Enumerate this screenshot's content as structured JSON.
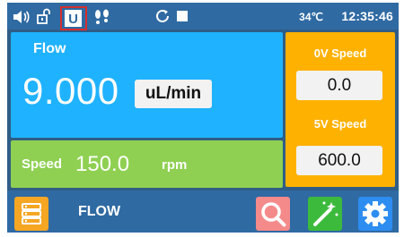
{
  "status_bar": {
    "temperature": "34℃",
    "time": "12:35:46",
    "icons": [
      "speaker-icon",
      "unlock-icon",
      "u-mode-icon",
      "footprint-icon",
      "refresh-icon",
      "stop-icon"
    ]
  },
  "flow_panel": {
    "title": "Flow",
    "value": "9.000",
    "unit": "uL/min"
  },
  "speed_panel": {
    "label": "Speed",
    "value": "150.0",
    "unit": "rpm"
  },
  "right_panel": {
    "zero_v_label": "0V Speed",
    "zero_v_value": "0.0",
    "five_v_label": "5V Speed",
    "five_v_value": "600.0"
  },
  "bottom_bar": {
    "mode_label": "FLOW",
    "icons": [
      "menu-list-icon",
      "search-icon",
      "magic-wand-icon",
      "settings-gear-icon"
    ]
  },
  "colors": {
    "status_bar": "#2f6aa2",
    "flow_panel": "#1fb2ff",
    "speed_panel": "#8fd052",
    "right_panel": "#ffb100",
    "menu_button": "#f5a623",
    "search_button": "#f58a8a",
    "wand_button": "#3cba3c",
    "settings_button": "#2d8df0",
    "highlight_outline": "#d32f2f"
  }
}
